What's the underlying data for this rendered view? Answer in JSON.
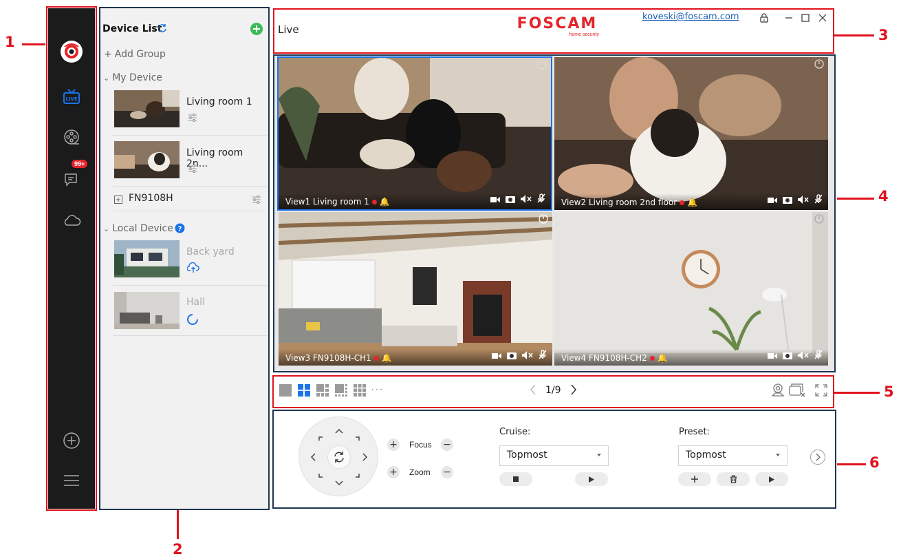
{
  "callouts": [
    "1",
    "2",
    "3",
    "4",
    "5",
    "6"
  ],
  "colors": {
    "accent": "#e0121e",
    "sidebar_bg": "#1b1b1b",
    "panel_bg": "#f1f1f1",
    "frame": "#1e3550",
    "selected": "#1a73e8",
    "add_green": "#3dbb58",
    "badge": "#e4252c"
  },
  "sidebar": {
    "badge": "99+",
    "live_label": "LIVE",
    "icons": [
      "logo-icon",
      "live-icon",
      "playback-icon",
      "messages-icon",
      "cloud-icon",
      "add-device-icon",
      "menu-icon"
    ]
  },
  "device_panel": {
    "title": "Device List",
    "add_group": "Add Group",
    "my_device_group": "My Device",
    "local_device_group": "Local Device",
    "devices": [
      {
        "name": "Living room 1"
      },
      {
        "name": "Living room 2n..."
      },
      {
        "name": "FN9108H"
      }
    ],
    "local_devices": [
      {
        "name": "Back yard"
      },
      {
        "name": "Hall"
      }
    ]
  },
  "header": {
    "title": "Live",
    "brand": "FOSCAM",
    "brand_tagline": "home security",
    "user_email": "koveski@foscam.com"
  },
  "views": [
    {
      "label": "View1 Living room 1"
    },
    {
      "label": "View2 Living room 2nd floor"
    },
    {
      "label": "View3 FN9108H-CH1"
    },
    {
      "label": "View4  FN9108H-CH2"
    }
  ],
  "toolbar": {
    "page": "1/9",
    "more": "···"
  },
  "ptz": {
    "focus_label": "Focus",
    "zoom_label": "Zoom",
    "cruise_label": "Cruise:",
    "cruise_value": "Topmost",
    "preset_label": "Preset:",
    "preset_value": "Topmost"
  }
}
